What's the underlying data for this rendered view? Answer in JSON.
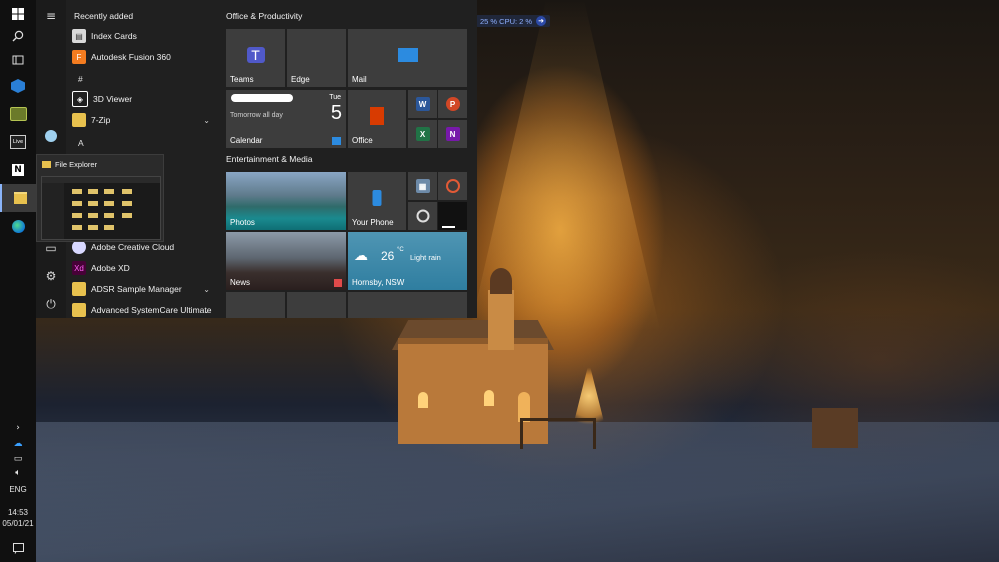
{
  "taskbar": {
    "tray_language": "ENG",
    "clock_time": "14:53",
    "clock_date": "05/01/21"
  },
  "start_menu": {
    "rail": {
      "menu_icon": "hamburger-icon"
    },
    "app_list": {
      "section_header": "Recently added",
      "recent": [
        {
          "label": "Index Cards",
          "icon": "index-cards-icon",
          "color": "#e6e6e6"
        },
        {
          "label": "Autodesk Fusion 360",
          "icon": "fusion360-icon",
          "color": "#f47c20"
        }
      ],
      "letter_hash": "#",
      "hash_apps": [
        {
          "label": "3D Viewer",
          "icon": "3d-viewer-icon",
          "color": "#ffffff"
        },
        {
          "label": "7-Zip",
          "icon": "folder-icon",
          "color": "#e8c14e"
        }
      ],
      "letter_a": "A",
      "a_apps": [
        {
          "label": "Adobe Creative Cloud",
          "icon": "adobe-cc-icon",
          "color": "#d8d8ff"
        },
        {
          "label": "Adobe XD",
          "icon": "adobe-xd-icon",
          "color": "#470137"
        },
        {
          "label": "ADSR Sample Manager",
          "icon": "folder-icon",
          "color": "#e8c14e"
        },
        {
          "label": "Advanced SystemCare Ultimate",
          "icon": "folder-icon",
          "color": "#e8c14e"
        }
      ]
    },
    "groups": {
      "productivity_title": "Office & Productivity",
      "entertainment_title": "Entertainment & Media"
    },
    "tiles": {
      "teams": "Teams",
      "edge": "Edge",
      "mail": "Mail",
      "calendar": "Calendar",
      "calendar_day": "Tue",
      "calendar_date": "5",
      "calendar_event": "Tomorrow all day",
      "office": "Office",
      "photos": "Photos",
      "your_phone": "Your Phone",
      "news": "News",
      "weather_temp": "26",
      "weather_unit": "°C",
      "weather_cond": "Light rain",
      "weather_place": "Hornsby, NSW"
    }
  },
  "file_explorer_preview": {
    "title": "File Explorer"
  },
  "perf_overlay": {
    "text": "25 %  CPU: 2 %"
  },
  "colors": {
    "accent": "#8ab4f8",
    "start_bg": "#202020",
    "tile_bg": "#3d3d3d"
  }
}
